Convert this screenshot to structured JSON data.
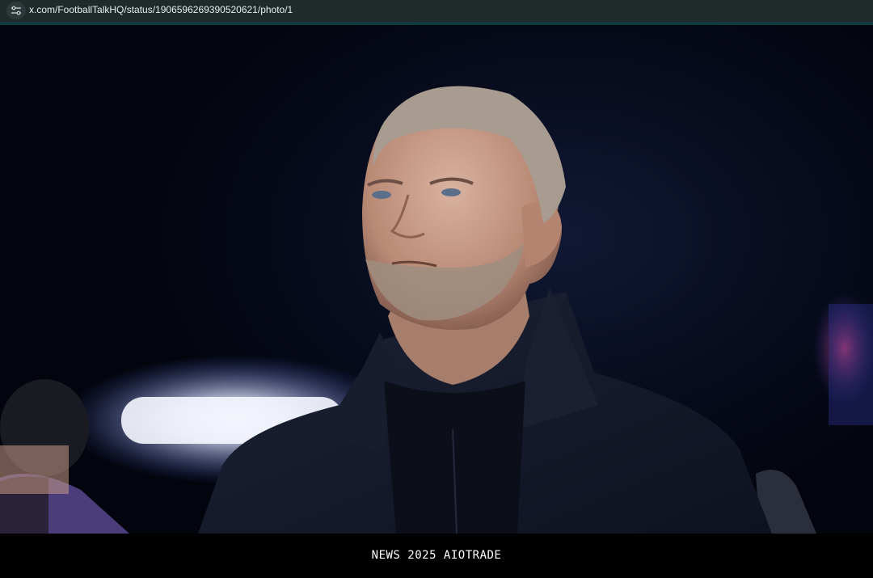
{
  "browser": {
    "url": "x.com/FootballTalkHQ/status/1906596269390520621/photo/1",
    "site_info_icon": "tune-icon"
  },
  "photo": {
    "subject": "man-in-dark-jacket",
    "colors": {
      "background": "#070b1c",
      "jacket": "#14192a",
      "skin": "#c49a86",
      "hair": "#a79c8f",
      "stadium_light": "#f4f6ff"
    }
  },
  "caption": {
    "text": "NEWS 2025 AIOTRADE"
  }
}
